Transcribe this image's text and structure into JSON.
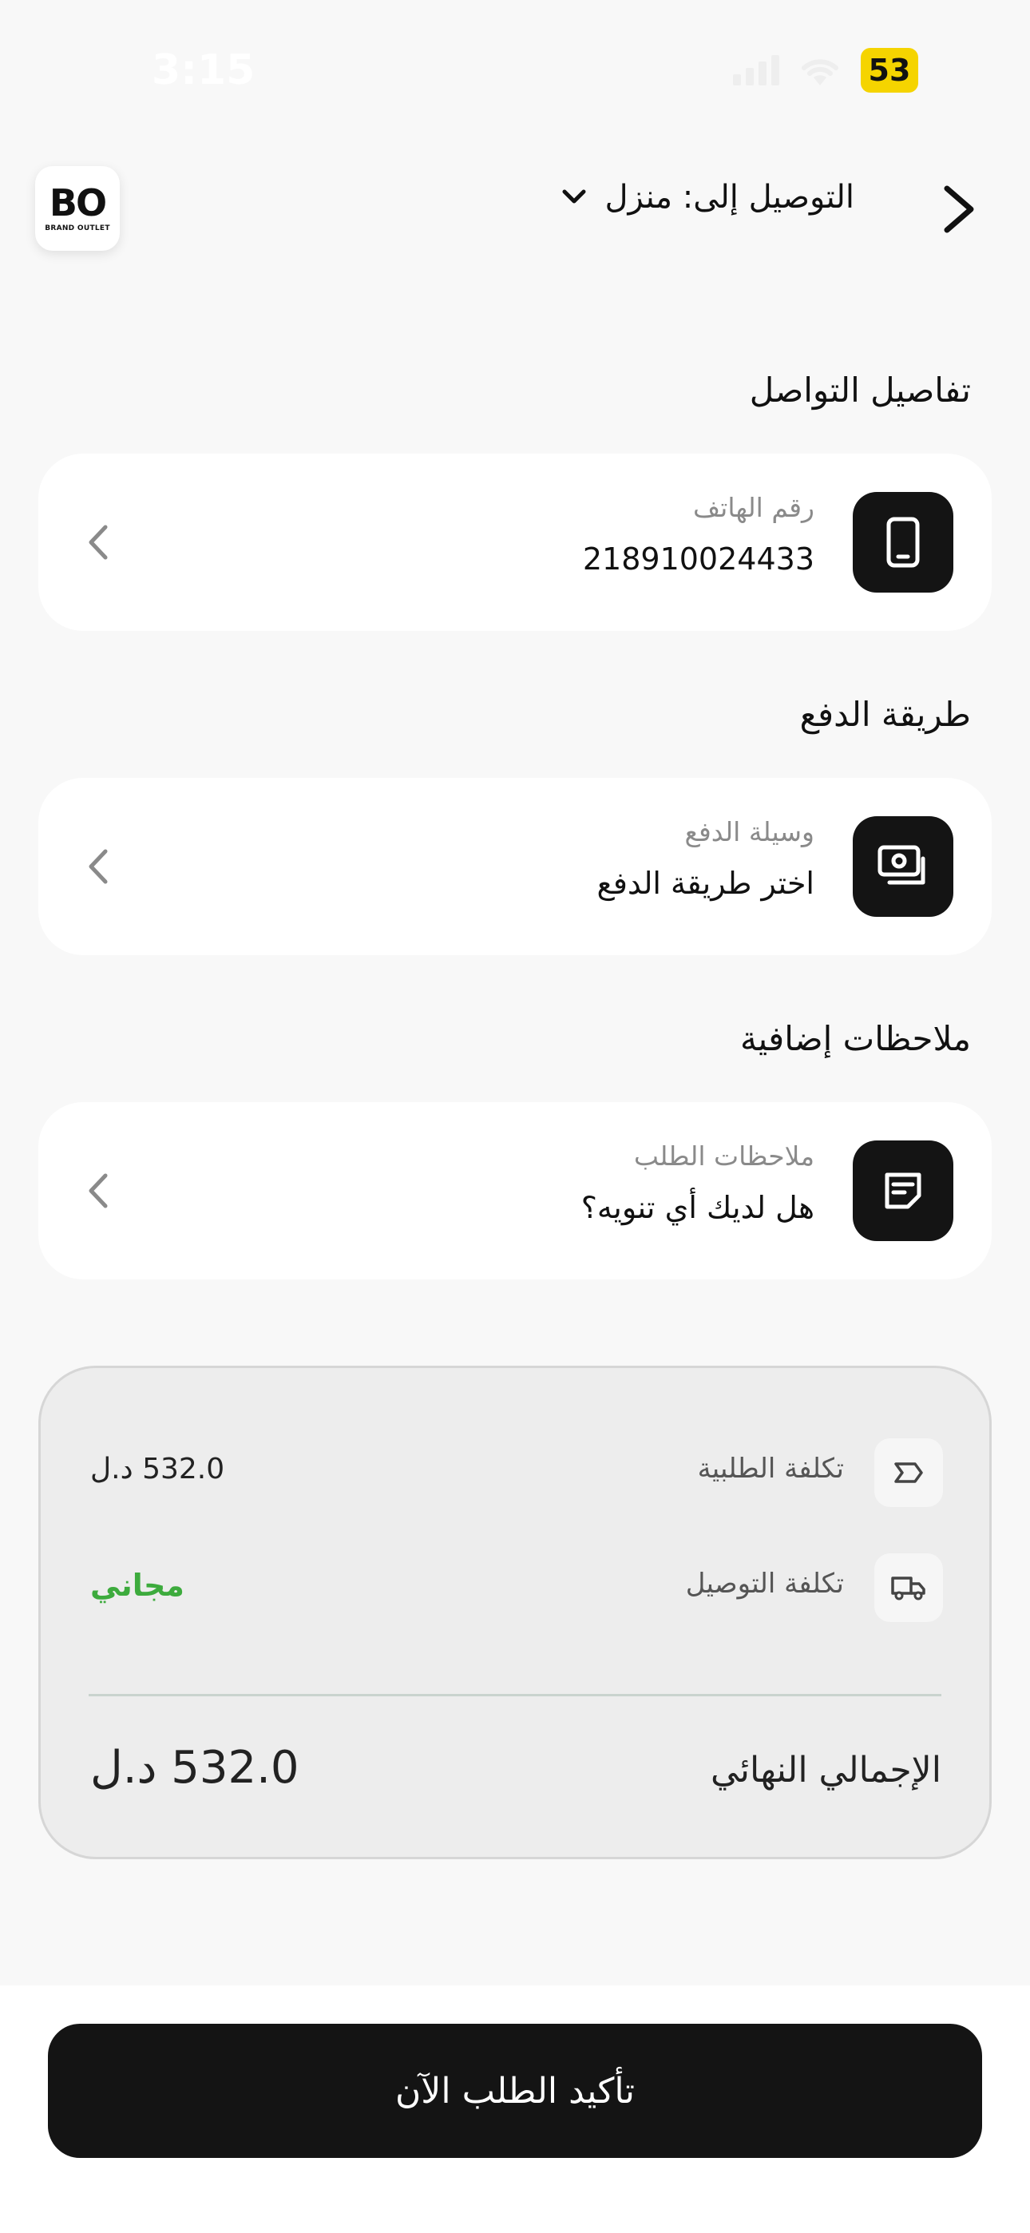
{
  "status_bar": {
    "time": "3:15",
    "battery": "53"
  },
  "header": {
    "delivery_label": "التوصيل إلى: منزل",
    "logo_main": "BO",
    "logo_sub": "BRAND OUTLET"
  },
  "sections": {
    "contact": {
      "title": "تفاصيل التواصل",
      "label": "رقم الهاتف",
      "value": "218910024433"
    },
    "payment": {
      "title": "طريقة الدفع",
      "label": "وسيلة الدفع",
      "value": "اختر طريقة الدفع"
    },
    "notes": {
      "title": "ملاحظات إضافية",
      "label": "ملاحظات الطلب",
      "value": "هل لديك أي تنويه؟"
    }
  },
  "summary": {
    "order_cost_label": "تكلفة الطلبية",
    "order_cost_value": "532.0 د.ل",
    "delivery_cost_label": "تكلفة التوصيل",
    "delivery_cost_value": "مجاني",
    "total_label": "الإجمالي النهائي",
    "total_value": "532.0 د.ل"
  },
  "confirm_button": "تأكيد الطلب الآن",
  "colors": {
    "free": "#3dab3d",
    "dark": "#141414",
    "battery": "#f5d400"
  }
}
